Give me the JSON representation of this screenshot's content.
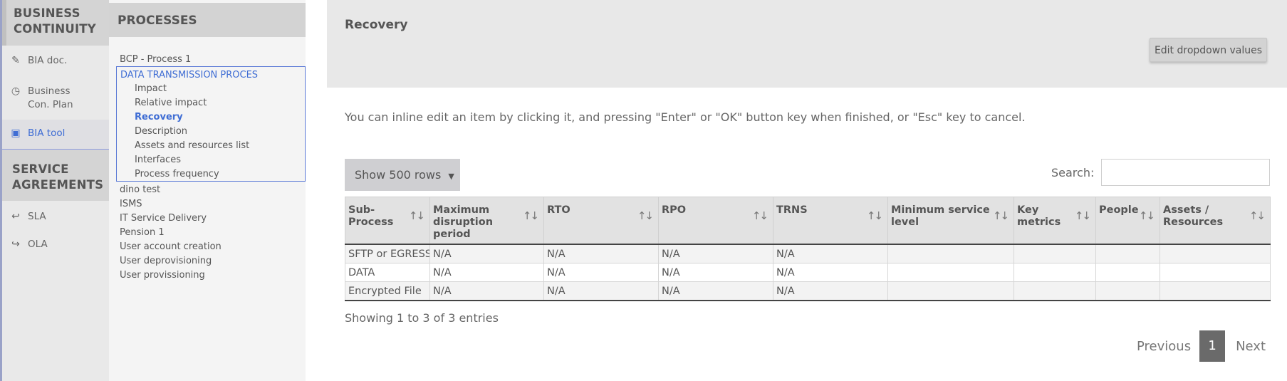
{
  "sidebar": {
    "section1_title": "BUSINESS CONTINUITY",
    "items1": [
      {
        "label": "BIA doc.",
        "icon": "document-edit-icon"
      },
      {
        "label": "Business Con. Plan",
        "icon": "clock-icon"
      },
      {
        "label": "BIA tool",
        "icon": "briefcase-icon"
      }
    ],
    "section2_title": "SERVICE AGREEMENTS",
    "items2": [
      {
        "label": "SLA",
        "icon": "reply-icon"
      },
      {
        "label": "OLA",
        "icon": "share-icon"
      }
    ]
  },
  "processes": {
    "title": "PROCESSES",
    "top_item": "BCP - Process 1",
    "group_title": "DATA TRANSMISSION PROCES",
    "group_items": [
      "Impact",
      "Relative impact",
      "Recovery",
      "Description",
      "Assets and resources list",
      "Interfaces",
      "Process frequency"
    ],
    "selected_item": "Recovery",
    "other_items": [
      "dino test",
      "ISMS",
      "IT Service Delivery",
      "Pension 1",
      "User account creation",
      "User deprovisioning",
      "User provissioning"
    ]
  },
  "main": {
    "title": "Recovery",
    "edit_button": "Edit dropdown values",
    "hint": "You can inline edit an item by clicking it, and pressing \"Enter\" or \"OK\" button key when finished, or \"Esc\" key to cancel.",
    "show_rows": "Show 500 rows",
    "search_label": "Search:",
    "search_value": "",
    "columns": [
      "Sub-Process",
      "Maximum disruption period",
      "RTO",
      "RPO",
      "TRNS",
      "Minimum service level",
      "Key metrics",
      "People",
      "Assets / Resources"
    ],
    "rows": [
      [
        "SFTP or EGRESS",
        "N/A",
        "N/A",
        "N/A",
        "N/A",
        "",
        "",
        "",
        ""
      ],
      [
        "DATA",
        "N/A",
        "N/A",
        "N/A",
        "N/A",
        "",
        "",
        "",
        ""
      ],
      [
        "Encrypted File",
        "N/A",
        "N/A",
        "N/A",
        "N/A",
        "",
        "",
        "",
        ""
      ]
    ],
    "showing": "Showing 1 to 3 of 3 entries",
    "pager": {
      "previous": "Previous",
      "page": "1",
      "next": "Next"
    }
  },
  "colors": {
    "accent": "#3f6dd4",
    "header_bg": "#e8e8e8",
    "sidebar_bg": "#e9e9e9"
  }
}
